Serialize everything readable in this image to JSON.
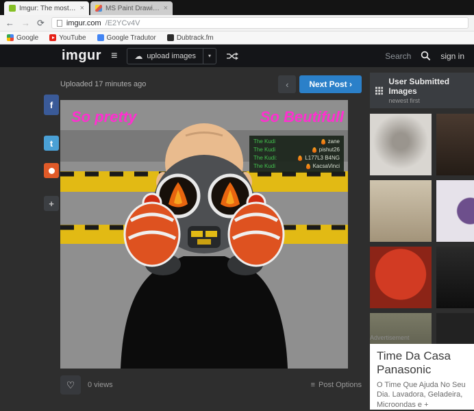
{
  "browser": {
    "tab1": {
      "title": "Imgur: The most awesom...",
      "close": "×"
    },
    "tab2": {
      "title": "MS Paint Drawings! - Pag...",
      "close": "×"
    },
    "back": "←",
    "forward": "→",
    "refresh": "⟳",
    "url_host": "imgur.com",
    "url_path": "/E2YCv4V",
    "bookmarks": [
      {
        "label": "Google"
      },
      {
        "label": "YouTube"
      },
      {
        "label": "Google Tradutor"
      },
      {
        "label": "Dubtrack.fm"
      }
    ]
  },
  "header": {
    "logo": "imgur",
    "menu_icon": "≡",
    "upload_label": "upload images",
    "caret": "▾",
    "cloud_icon": "☁",
    "search_label": "Search",
    "signin_label": "sign in"
  },
  "post": {
    "uploaded": "Uploaded 17 minutes ago",
    "prev": "‹",
    "next": "Next Post ›",
    "caption_left": "So pretty",
    "caption_right": "So Beutifull",
    "chat": [
      {
        "user": "The Kudi",
        "name": "zane"
      },
      {
        "user": "The Kudi",
        "name": "pishut26"
      },
      {
        "user": "The Kudi:",
        "name": "L177L3 B4NG"
      },
      {
        "user": "The Kudi",
        "name": "KacsaVinci"
      }
    ],
    "heart_icon": "♡",
    "views": "0 views",
    "options_icon": "≡",
    "options": "Post Options"
  },
  "social": {
    "facebook": "f",
    "twitter": "t",
    "plus": "+"
  },
  "sidebar": {
    "title": "User Submitted Images",
    "subtitle": "newest first"
  },
  "ad": {
    "label": "Advertisement",
    "title": "Time Da Casa Panasonic",
    "body": "O Time Que Ajuda No Seu Dia. Lavadora, Geladeira, Microondas e +"
  },
  "colors": {
    "accent_blue": "#2b80c9",
    "imgur_header": "#141518",
    "caption_pink": "#ff2fd0",
    "page_bg": "#2e2e2e"
  }
}
